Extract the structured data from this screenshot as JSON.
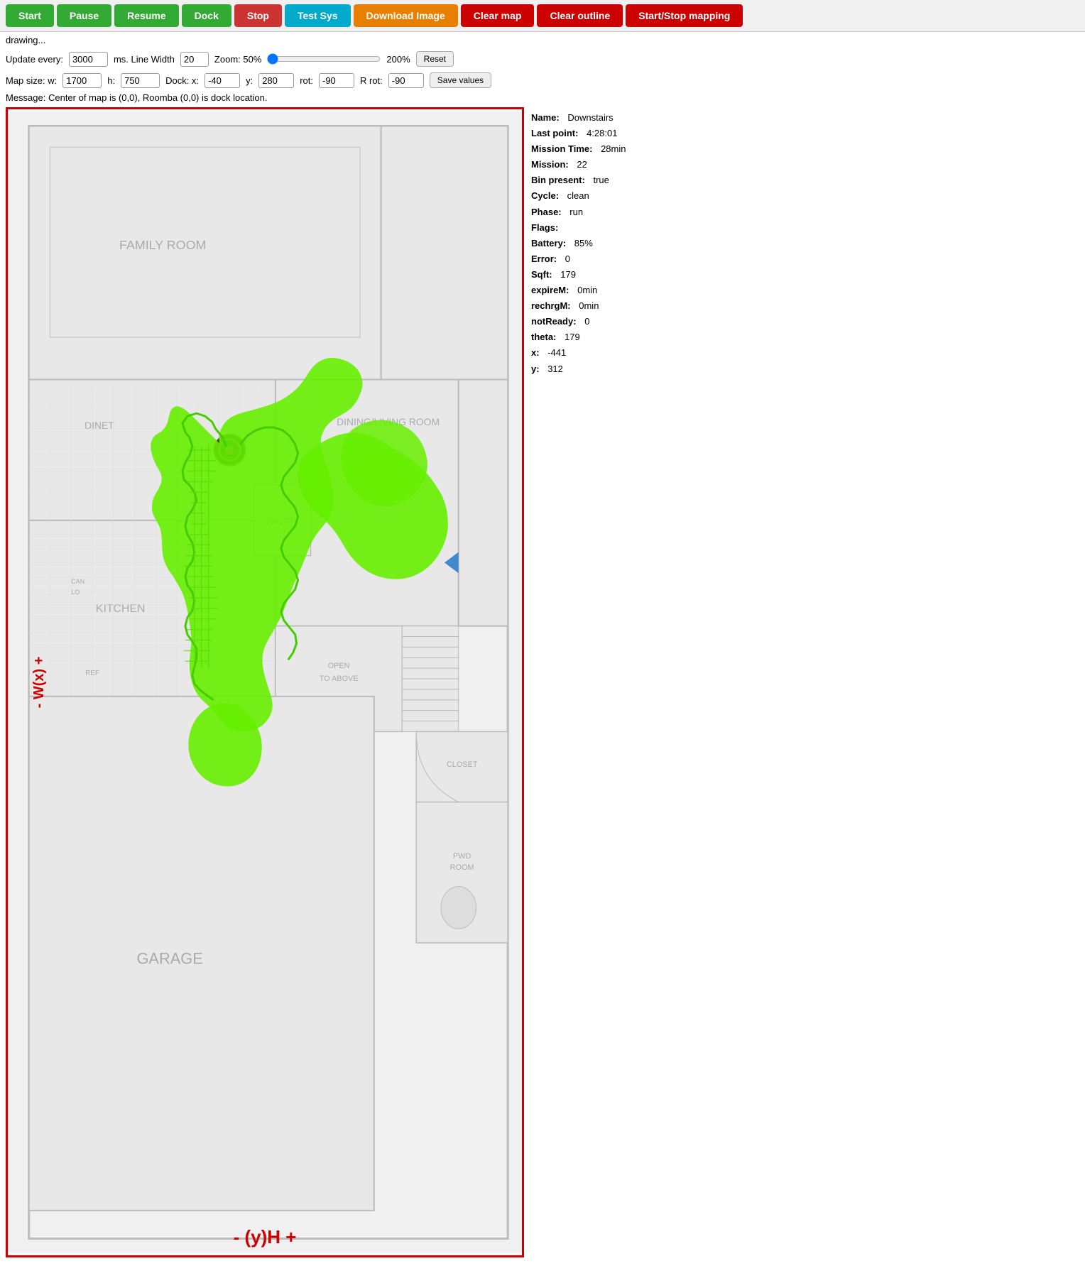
{
  "toolbar": {
    "start_label": "Start",
    "pause_label": "Pause",
    "resume_label": "Resume",
    "dock_label": "Dock",
    "stop_label": "Stop",
    "test_sys_label": "Test Sys",
    "download_image_label": "Download Image",
    "clear_map_label": "Clear map",
    "clear_outline_label": "Clear outline",
    "start_stop_mapping_label": "Start/Stop mapping"
  },
  "controls": {
    "update_label": "Update every:",
    "update_value": "3000",
    "ms_label": "ms. Line Width",
    "line_width_value": "20",
    "zoom_label": "Zoom: 50%",
    "zoom_min": "50",
    "zoom_max": "200",
    "zoom_pct_label": "200%",
    "reset_label": "Reset"
  },
  "map_size": {
    "label": "Map size: w:",
    "w_value": "1700",
    "h_label": "h:",
    "h_value": "750",
    "dock_label": "Dock: x:",
    "x_value": "-40",
    "y_label": "y:",
    "y_value": "280",
    "rot_label": "rot:",
    "rot_value": "-90",
    "r_rot_label": "R rot:",
    "r_rot_value": "-90",
    "save_label": "Save values"
  },
  "message": {
    "text": "Message: Center of map is (0,0), Roomba (0,0) is dock location."
  },
  "status": {
    "drawing": "drawing..."
  },
  "info": {
    "name_label": "Name:",
    "name_value": "Downstairs",
    "last_point_label": "Last point:",
    "last_point_value": "4:28:01",
    "mission_time_label": "Mission Time:",
    "mission_time_value": "28min",
    "mission_label": "Mission:",
    "mission_value": "22",
    "bin_present_label": "Bin present:",
    "bin_present_value": "true",
    "cycle_label": "Cycle:",
    "cycle_value": "clean",
    "phase_label": "Phase:",
    "phase_value": "run",
    "flags_label": "Flags:",
    "flags_value": "",
    "battery_label": "Battery:",
    "battery_value": "85%",
    "error_label": "Error:",
    "error_value": "0",
    "sqft_label": "Sqft:",
    "sqft_value": "179",
    "expire_m_label": "expireM:",
    "expire_m_value": "0min",
    "rechrg_m_label": "rechrgM:",
    "rechrg_m_value": "0min",
    "not_ready_label": "notReady:",
    "not_ready_value": "0",
    "theta_label": "theta:",
    "theta_value": "179",
    "x_label": "x:",
    "x_value": "-441",
    "y_label": "y:",
    "y_value": "312"
  },
  "map": {
    "family_room": "FAMILY ROOM",
    "dining_living": "DINING/LIVING ROOM",
    "dinet": "DINET",
    "kitchen": "KITCHEN",
    "pantry": "PANTRY",
    "open_to_above": "OPEN\nTO ABOVE",
    "garage": "GARAGE",
    "closet": "CLOSET",
    "pwd_room": "PWD\nROOM",
    "axis_w": "- W(x) +",
    "axis_h": "- (y)H +"
  }
}
